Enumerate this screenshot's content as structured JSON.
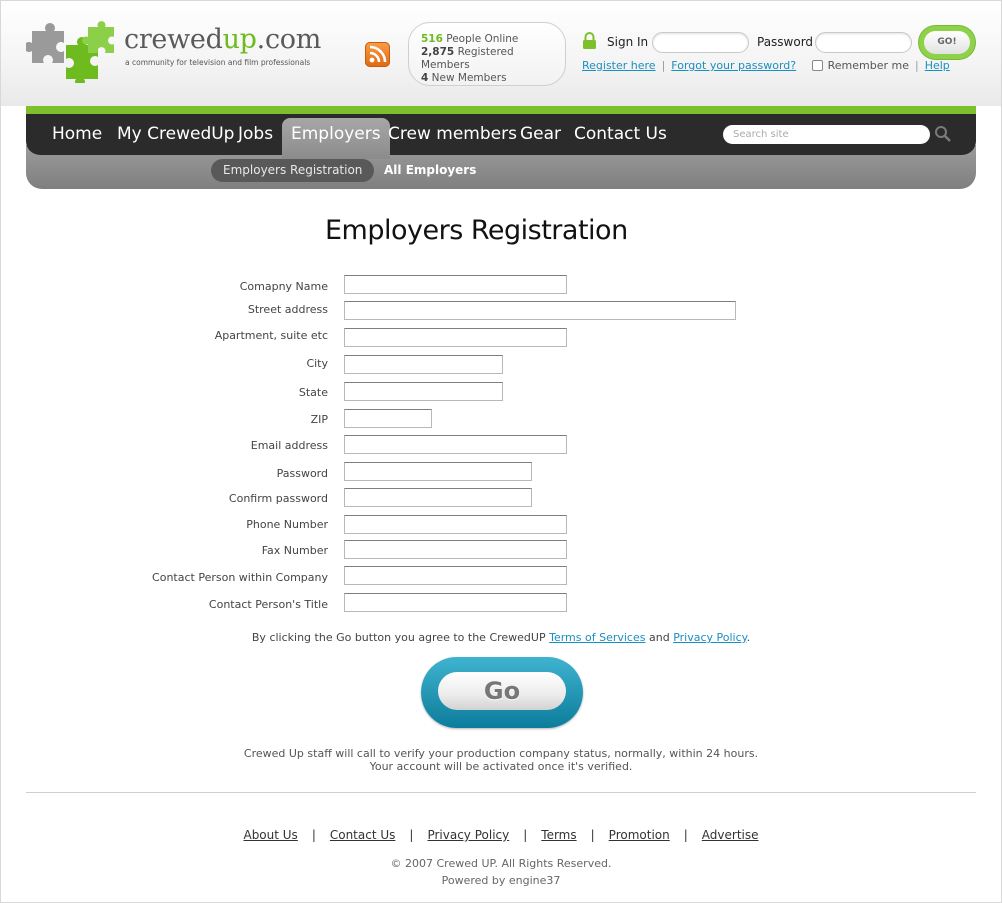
{
  "header": {
    "logo_text_a": "crewed",
    "logo_text_b": "up",
    "logo_text_c": ".com",
    "tagline": "a community for television and film professionals",
    "stats": {
      "online_count": "516",
      "online_label": "People Online",
      "registered_count": "2,875",
      "registered_label": "Registered Members",
      "new_count": "4",
      "new_label": "New Members"
    },
    "login": {
      "signin_label": "Sign In",
      "password_label": "Password",
      "go_label": "GO!",
      "register_link": "Register here",
      "forgot_link": "Forgot your password?",
      "remember_label": "Remember me",
      "help_link": "Help"
    }
  },
  "nav": {
    "items": [
      "Home",
      "My CrewedUp",
      "Jobs",
      "Employers",
      "Crew members",
      "Gear",
      "Contact Us"
    ],
    "active": "Employers",
    "search_placeholder": "Search site",
    "sub_items": [
      "Employers Registration",
      "All Employers"
    ]
  },
  "main": {
    "title": "Employers Registration",
    "form": [
      {
        "label": "Comapny Name"
      },
      {
        "label": "Street address"
      },
      {
        "label": "Apartment, suite etc"
      },
      {
        "label": "City"
      },
      {
        "label": "State"
      },
      {
        "label": "ZIP"
      },
      {
        "label": "Email address"
      },
      {
        "label": "Password"
      },
      {
        "label": "Confirm password"
      },
      {
        "label": "Phone Number"
      },
      {
        "label": "Fax Number"
      },
      {
        "label": "Contact Person within Company"
      },
      {
        "label": "Contact Person's Title"
      }
    ],
    "agree_prefix": "By clicking the Go button you agree to the CrewedUP",
    "terms_link": "Terms of Services",
    "agree_and": "and",
    "privacy_link": "Privacy Policy",
    "agree_suffix": ".",
    "go_label": "Go",
    "verify_line1": "Crewed Up staff will call to verify your production company status, normally, within 24 hours.",
    "verify_line2": "Your account will be activated once it's verified."
  },
  "footer": {
    "links": [
      "About Us",
      "Contact Us",
      "Privacy Policy",
      "Terms",
      "Promotion",
      "Advertise"
    ],
    "copyright": "© 2007 Crewed UP. All Rights Reserved.",
    "powered": "Powered by engine37"
  },
  "colors": {
    "brand_green": "#7dc02c",
    "link_blue": "#1a8fc0",
    "nav_dark": "#2b2b2b",
    "go_teal": "#0c7d9c"
  }
}
